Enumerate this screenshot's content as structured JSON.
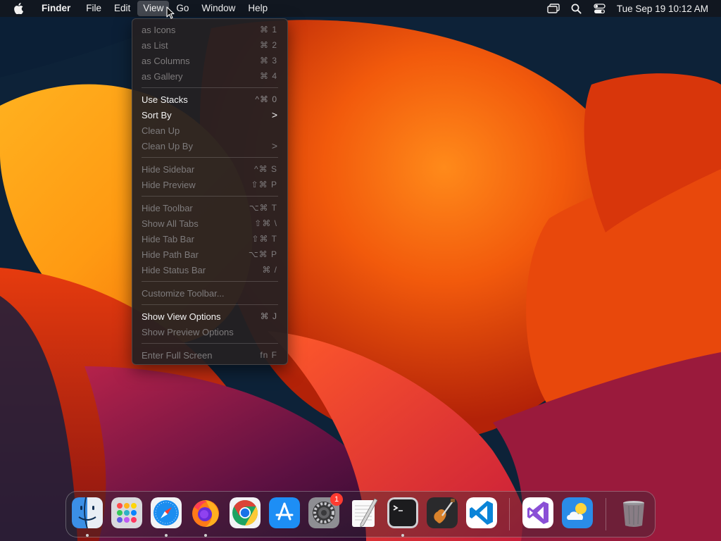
{
  "menubar": {
    "app_name": "Finder",
    "items": [
      "File",
      "Edit",
      "View",
      "Go",
      "Window",
      "Help"
    ],
    "active_item": "View",
    "clock": "Tue Sep 19  10:12 AM",
    "status_icons": [
      "screen-mirroring-icon",
      "search-icon",
      "control-center-icon"
    ]
  },
  "view_menu": {
    "items": [
      {
        "label": "as Icons",
        "shortcut": "⌘ 1",
        "enabled": false
      },
      {
        "label": "as List",
        "shortcut": "⌘ 2",
        "enabled": false
      },
      {
        "label": "as Columns",
        "shortcut": "⌘ 3",
        "enabled": false
      },
      {
        "label": "as Gallery",
        "shortcut": "⌘ 4",
        "enabled": false
      },
      {
        "label": "Use Stacks",
        "shortcut": "^⌘ 0",
        "enabled": true
      },
      {
        "label": "Sort By",
        "shortcut": ">",
        "enabled": true
      },
      {
        "label": "Clean Up",
        "shortcut": "",
        "enabled": false
      },
      {
        "label": "Clean Up By",
        "shortcut": ">",
        "enabled": false
      },
      {
        "label": "Hide Sidebar",
        "shortcut": "^⌘ S",
        "enabled": false
      },
      {
        "label": "Hide Preview",
        "shortcut": "⇧⌘ P",
        "enabled": false
      },
      {
        "label": "Hide Toolbar",
        "shortcut": "⌥⌘ T",
        "enabled": false
      },
      {
        "label": "Show All Tabs",
        "shortcut": "⇧⌘ \\",
        "enabled": false
      },
      {
        "label": "Hide Tab Bar",
        "shortcut": "⇧⌘ T",
        "enabled": false
      },
      {
        "label": "Hide Path Bar",
        "shortcut": "⌥⌘ P",
        "enabled": false
      },
      {
        "label": "Hide Status Bar",
        "shortcut": "⌘ /",
        "enabled": false
      },
      {
        "label": "Customize Toolbar...",
        "shortcut": "",
        "enabled": false
      },
      {
        "label": "Show View Options",
        "shortcut": "⌘ J",
        "enabled": true
      },
      {
        "label": "Show Preview Options",
        "shortcut": "",
        "enabled": false
      },
      {
        "label": "Enter Full Screen",
        "shortcut": "fn F",
        "enabled": false
      }
    ]
  },
  "dock": {
    "apps": [
      {
        "name": "finder-icon",
        "running": true
      },
      {
        "name": "launchpad-icon",
        "running": false
      },
      {
        "name": "safari-icon",
        "running": true
      },
      {
        "name": "firefox-icon",
        "running": true
      },
      {
        "name": "chrome-icon",
        "running": false
      },
      {
        "name": "app-store-icon",
        "running": false
      },
      {
        "name": "system-settings-icon",
        "running": false,
        "badge": "1"
      },
      {
        "name": "textedit-icon",
        "running": false
      },
      {
        "name": "terminal-icon",
        "running": true
      },
      {
        "name": "garageband-icon",
        "running": false
      },
      {
        "name": "vscode-icon",
        "running": false
      },
      {
        "name": "visual-studio-icon",
        "running": false
      },
      {
        "name": "weather-icon",
        "running": false
      },
      {
        "name": "trash-icon",
        "running": false
      }
    ]
  }
}
